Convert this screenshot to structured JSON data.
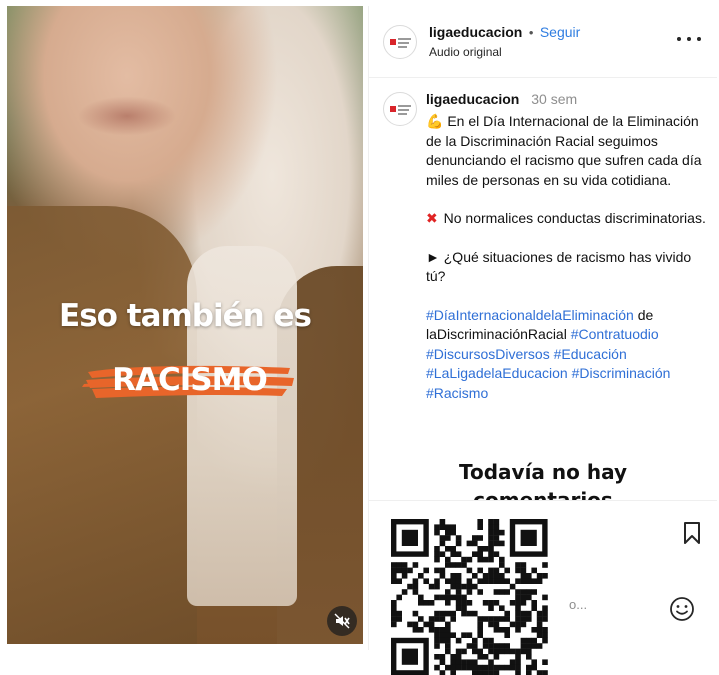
{
  "media": {
    "headline": "Eso también es",
    "highlight_word": "RACISMO",
    "mute_icon": "speaker-muted-icon",
    "accent_color": "#e8652a"
  },
  "post": {
    "header": {
      "username": "ligaeducacion",
      "separator": "•",
      "follow_label": "Seguir",
      "subtitle": "Audio original",
      "more_icon": "more-horizontal-icon"
    },
    "caption": {
      "username": "ligaeducacion",
      "time": "30 sem",
      "para1_emoji": "💪",
      "para1": "En el Día Internacional de la Eliminación de la Discriminación Racial seguimos denunciando el racismo que sufren cada día miles de personas en su vida cotidiana.",
      "para2_emoji": "✖",
      "para2": "No normalices conductas discriminatorias.",
      "para3_emoji": "►",
      "para3": "¿Qué situaciones de racismo has vivido tú?",
      "hashtags": {
        "h1": "#DíaInternacionaldelaEliminación",
        "h1_rest": "de laDiscriminaciónRacial",
        "h2": "#Contratuodio",
        "h3": "#DiscursosDiversos",
        "h4": "#Educación",
        "h5": "#LaLigadelaEducacion",
        "h6": "#Discriminación",
        "h7": "#Racismo"
      }
    },
    "no_comments_line1": "Todavía no hay",
    "no_comments_line2": "comentarios",
    "actions": {
      "bookmark_icon": "bookmark-icon",
      "comment_placeholder_tail": "o...",
      "emoji_icon": "smiley-icon"
    }
  },
  "overlay": {
    "qr_icon": "qr-code-icon"
  },
  "colors": {
    "link_blue": "#2f7de1",
    "hashtag_blue": "#2f6fd6",
    "muted_gray": "#8e8e8e",
    "brand_red": "#d9252b"
  }
}
